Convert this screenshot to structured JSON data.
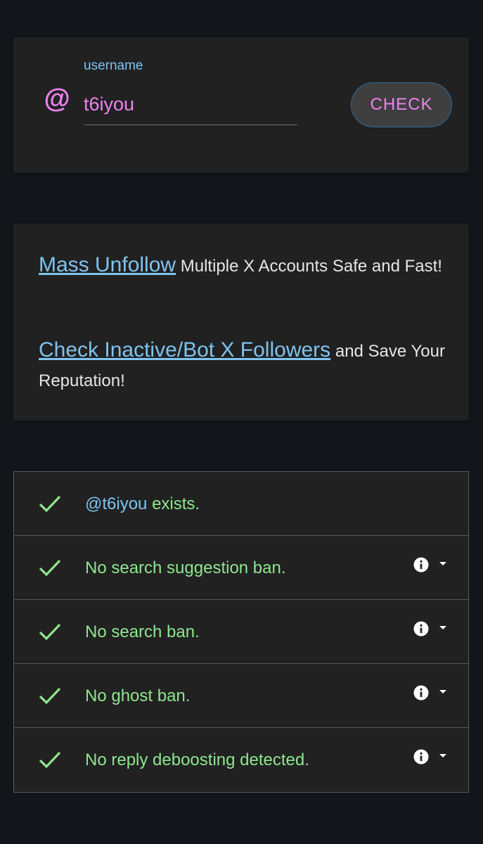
{
  "search": {
    "label": "username",
    "value": "t6iyou",
    "at_symbol": "@",
    "button_label": "CHECK"
  },
  "promo": {
    "line1_link": "Mass Unfollow",
    "line1_text": " Multiple X Accounts Safe and Fast!",
    "line2_link": "Check Inactive/Bot X Followers",
    "line2_text": " and Save Your Reputation!"
  },
  "results": [
    {
      "handle": "@t6iyou",
      "text": " exists.",
      "has_info": false
    },
    {
      "handle": "",
      "text": "No search suggestion ban.",
      "has_info": true
    },
    {
      "handle": "",
      "text": "No search ban.",
      "has_info": true
    },
    {
      "handle": "",
      "text": "No ghost ban.",
      "has_info": true
    },
    {
      "handle": "",
      "text": "No reply deboosting detected.",
      "has_info": true
    }
  ],
  "colors": {
    "background": "#12161a",
    "card": "#212121",
    "accent_pink": "#ee82ee",
    "accent_blue": "#7ec3f0",
    "success_green": "#8ee68e"
  },
  "icons": {
    "status": "check-icon",
    "info": "info-icon",
    "expand": "caret-down-icon"
  }
}
